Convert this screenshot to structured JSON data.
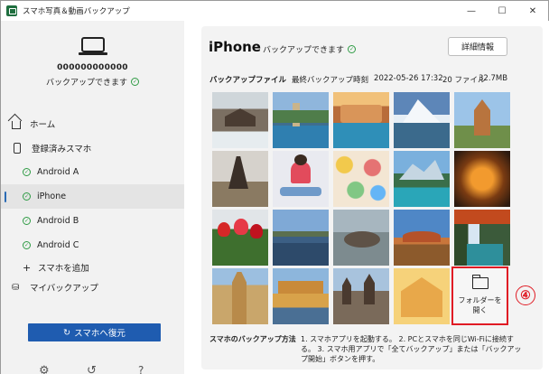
{
  "window": {
    "title": "スマホ写真＆動画バックアップ",
    "controls": {
      "minimize": "—",
      "maximize": "☐",
      "close": "✕"
    }
  },
  "sidebar": {
    "device_id": "000000000000",
    "device_status": "バックアップできます",
    "nav": {
      "home": "ホーム",
      "registered": "登録済みスマホ",
      "devices": [
        "Android A",
        "iPhone",
        "Android B",
        "Android C"
      ],
      "add_phone": "スマホを追加",
      "my_backup": "マイバックアップ"
    },
    "restore_button": "スマホへ復元",
    "bottom_icons": [
      "gear-icon",
      "history-icon",
      "help-icon"
    ]
  },
  "main": {
    "title": "iPhone",
    "status": "バックアップできます",
    "details_button": "詳細情報",
    "info": {
      "label": "バックアップファイル",
      "last_label": "最終バックアップ時刻",
      "timestamp": "2022-05-26 17:32",
      "file_count": "20 ファイル",
      "size": "32.7MB"
    },
    "open_folder": {
      "line1": "フォルダーを",
      "line2": "開く"
    },
    "annotation": "④",
    "howto": {
      "title": "スマホのバックアップ方法",
      "text": "1. スマホアプリを起動する。 2. PCとスマホを同じWi-Fiに接続する。 3. スマホ用アプリで「全てバックアップ」または「バックアップ開始」ボタンを押す。"
    }
  },
  "colors": {
    "accent": "#1f5cb0",
    "check": "#2e9b44",
    "highlight": "#e01b24"
  }
}
